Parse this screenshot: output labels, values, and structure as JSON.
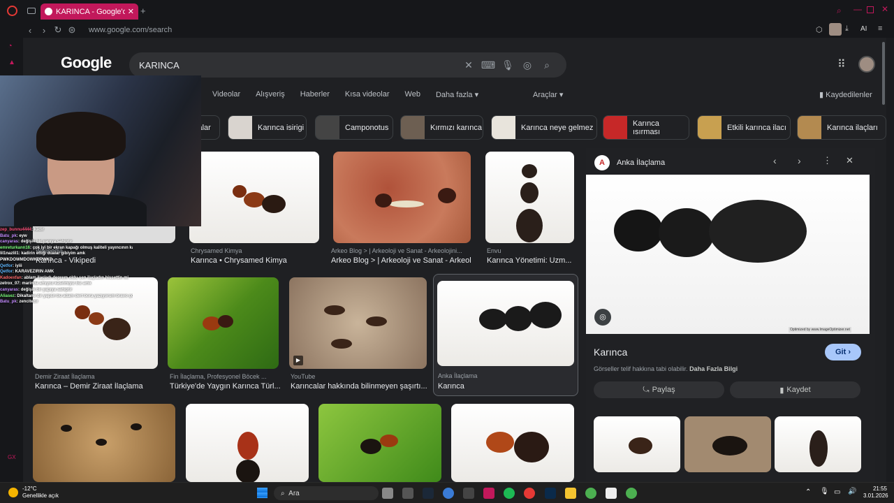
{
  "browser": {
    "tab_title": "KARINCA - Google'da Ara",
    "url": "www.google.com/search",
    "ai_label": "AI"
  },
  "google": {
    "logo": "Google",
    "query": "KARINCA",
    "tabs": [
      "Videolar",
      "Alışveriş",
      "Haberler",
      "Kısa videolar",
      "Web",
      "Daha fazla ▾"
    ],
    "tools": "Araçlar ▾",
    "saved": "Kaydedilenler",
    "chips": [
      "calar",
      "Karınca isirigi",
      "Camponotus",
      "Kırmızı karınca",
      "Karınca neye gelmez",
      "Karınca ısırması",
      "Etkili karınca ilacı",
      "Karınca ilaçları"
    ],
    "results": [
      {
        "source": "Wikipedia",
        "title": "Karınca - Vikipedi"
      },
      {
        "source": "Chrysamed Kimya",
        "title": "Karınca • Chrysamed Kimya"
      },
      {
        "source": "Arkeo Blog > | Arkeoloji ve Sanat - Arkeolojini...",
        "title": "Arkeo Blog > | Arkeoloji ve Sanat - Arkeol..."
      },
      {
        "source": "Envu",
        "title": "Karınca Yönetimi: Uzm..."
      },
      {
        "source": "Demir Ziraat İlaçlama",
        "title": "Karınca – Demir Ziraat İlaçlama"
      },
      {
        "source": "Fin İlaçlama, Profesyonel Böcek ...",
        "title": "Türkiye'de Yaygın Karınca Türl..."
      },
      {
        "source": "YouTube",
        "title": "Karıncalar hakkında bilinmeyen şaşırtı..."
      },
      {
        "source": "Anka İlaçlama",
        "title": "Karınca"
      }
    ],
    "panel": {
      "source": "Anka İlaçlama",
      "logo_letter": "A",
      "title": "Karınca",
      "visit": "Git ›",
      "license": "Görseller telif hakkına tabi olabilir.",
      "license_link": "Daha Fazla Bilgi",
      "share": "Paylaş",
      "save": "Kaydet",
      "watermark": "Optimized by www.ImageOptimizer.net"
    }
  },
  "chat": [
    {
      "user": "zep_bunnu4444",
      "msg": ": kadir",
      "color": "#ff4f7a"
    },
    {
      "user": "Batu_pk",
      "msg": ": eyw",
      "color": "#c48cff"
    },
    {
      "user": "canyaras",
      "msg": ": değişik bir yapıya sahiptir",
      "color": "#c48cff"
    },
    {
      "user": "emreturkann16",
      "msg": ": çok iyi bir ekran kapağı olmuş kaliteli yayıncının kaliteli işi @kadoex",
      "color": "#7cff7c"
    },
    {
      "user": "lil1nazlil1",
      "msg": ": kadirin ettiği dualar gibiyim amk",
      "color": "#ffffff"
    },
    {
      "user": "",
      "msg": "PWKDOWMDOWKDPWKD",
      "color": "#ffffff"
    },
    {
      "user": "Qetfor",
      "msg": ": iyiii",
      "color": "#5fb8ff"
    },
    {
      "user": "Qetfor",
      "msg": ": KARAVEZİRİN AMK",
      "color": "#5fb8ff"
    },
    {
      "user": "Kadoexfan",
      "msg": ": ablam ilaçladı deprem oldu sen ilaçladın hissettin mi",
      "color": "#ff6b6b"
    },
    {
      "user": "zetrox_07",
      "msg": ": marinda amıyoz kasifmiyiz biz amk",
      "color": "#ffffff"
    },
    {
      "user": "canyaras",
      "msg": ": değişik bir yapıya sahiptir",
      "color": "#c48cff"
    },
    {
      "user": "Aliasez",
      "msg": ": Dikaltane dir yapsn bu adam dert bora yazıyorum bravo çok güle 😊",
      "color": "#7cff7c"
    },
    {
      "user": "Batu_pk",
      "msg": ": zencitezir",
      "color": "#c48cff"
    }
  ],
  "taskbar": {
    "temp": "-12°C",
    "weather": "Genellikle açık",
    "search": "Ara",
    "time": "21:55",
    "date": "3.01.2026"
  }
}
